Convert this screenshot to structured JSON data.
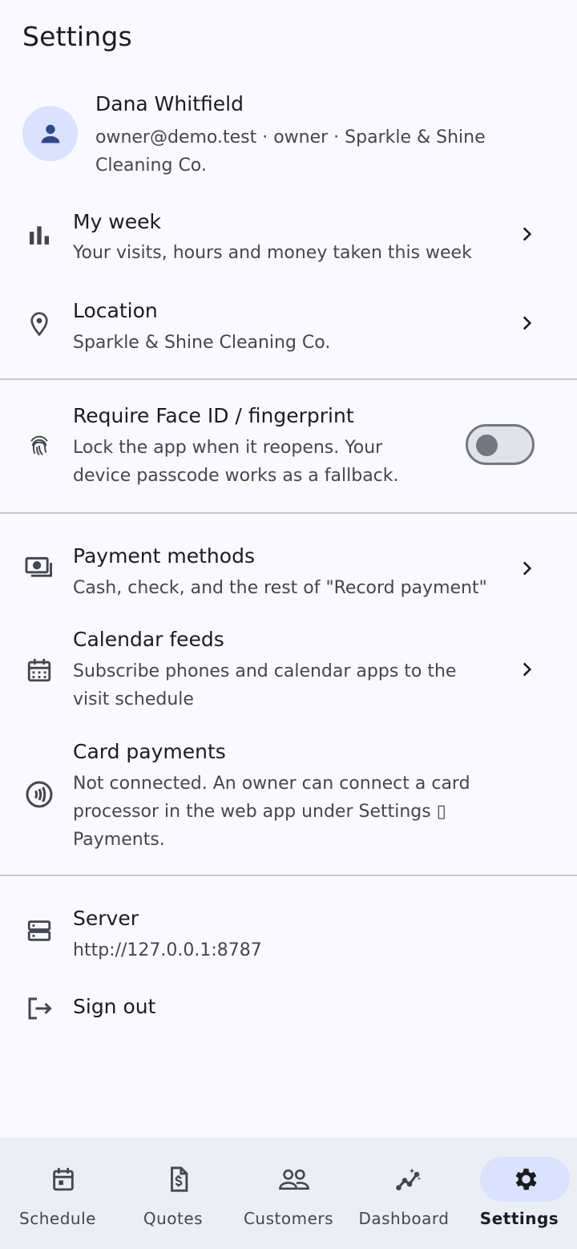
{
  "header": {
    "title": "Settings"
  },
  "profile": {
    "name": "Dana Whitfield",
    "details": "owner@demo.test · owner · Sparkle & Shine Cleaning Co."
  },
  "items": {
    "my_week": {
      "label": "My week",
      "sub": "Your visits, hours and money taken this week",
      "icon": "bar-chart-icon"
    },
    "location": {
      "label": "Location",
      "sub": "Sparkle & Shine Cleaning Co.",
      "icon": "location-pin-icon"
    },
    "biometric": {
      "label": "Require Face ID / fingerprint",
      "sub": "Lock the app when it reopens. Your device passcode works as a fallback.",
      "icon": "fingerprint-icon",
      "enabled": false
    },
    "payment_methods": {
      "label": "Payment methods",
      "sub": "Cash, check, and the rest of \"Record payment\"",
      "icon": "payments-icon"
    },
    "calendar_feeds": {
      "label": "Calendar feeds",
      "sub": "Subscribe phones and calendar apps to the visit schedule",
      "icon": "calendar-icon"
    },
    "card_payments": {
      "label": "Card payments",
      "sub": "Not connected. An owner can connect a card processor in the web app under Settings ▯ Payments.",
      "icon": "contactless-icon"
    },
    "server": {
      "label": "Server",
      "sub": "http://127.0.0.1:8787",
      "icon": "server-icon"
    },
    "sign_out": {
      "label": "Sign out",
      "icon": "logout-icon"
    }
  },
  "nav": {
    "items": [
      {
        "label": "Schedule",
        "icon": "calendar-today-icon"
      },
      {
        "label": "Quotes",
        "icon": "invoice-icon"
      },
      {
        "label": "Customers",
        "icon": "group-icon"
      },
      {
        "label": "Dashboard",
        "icon": "insights-icon"
      },
      {
        "label": "Settings",
        "icon": "gear-icon"
      }
    ],
    "active": "Settings"
  },
  "colors": {
    "accent_container": "#dae2fd",
    "background": "#f9f9ff",
    "nav_bg": "#eceef6"
  }
}
